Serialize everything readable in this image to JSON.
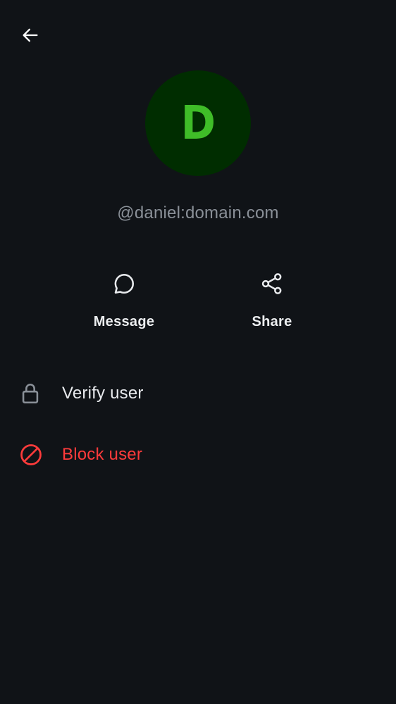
{
  "header": {
    "back_icon": "arrow-left-icon"
  },
  "profile": {
    "avatar_initial": "D",
    "avatar_bg": "#002d00",
    "avatar_fg": "#3fbd28",
    "user_id": "@daniel:domain.com"
  },
  "actions": [
    {
      "label": "Message",
      "icon": "chat-bubble-icon"
    },
    {
      "label": "Share",
      "icon": "share-icon"
    }
  ],
  "options": [
    {
      "label": "Verify user",
      "icon": "lock-icon",
      "color": "#e8eaed"
    },
    {
      "label": "Block user",
      "icon": "block-icon",
      "color": "#ff3b3b"
    }
  ],
  "colors": {
    "background": "#101317",
    "text": "#e8eaed",
    "muted": "#8a9098",
    "danger": "#ff3b3b"
  }
}
